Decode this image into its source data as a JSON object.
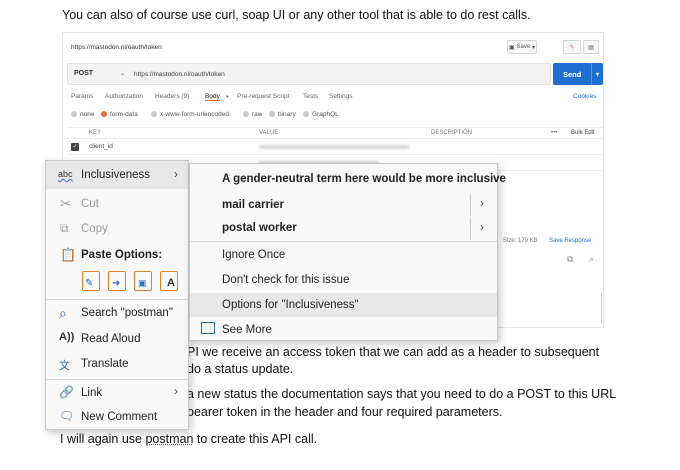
{
  "doc": {
    "para_top": "You can also of course use curl, soap UI or any other tool that is able to do rest calls.",
    "line1": "PI we receive an access token that we can add as a header to subsequent",
    "line2": "do a status update.",
    "line3": "a new status the documentation says that you need to do a POST to this URL",
    "line4": "bearer token in the header and four required parameters.",
    "line5_before": "I will again use ",
    "line5_word": "postman",
    "line5_after": " to create this API call."
  },
  "postman": {
    "tab_url": "https://mastodon.nl/oauth/token",
    "save_label": "Save",
    "method": "POST",
    "request_url": "https://mastodon.nl/oauth/token",
    "send_label": "Send",
    "tabs": [
      "Params",
      "Authorization",
      "Headers (9)",
      "Body",
      "Pre-request Script",
      "Tests",
      "Settings"
    ],
    "cookies": "Cookies",
    "body_types": [
      "none",
      "form-data",
      "x-www-form-urlencoded",
      "raw",
      "binary",
      "GraphQL"
    ],
    "columns": [
      "KEY",
      "VALUE",
      "DESCRIPTION",
      "Bulk Edit"
    ],
    "row1_key": "client_id",
    "size": "Size: 179 KB",
    "save_response": "Save Response"
  },
  "context_menu": {
    "inclusiveness": "Inclusiveness",
    "cut": "Cut",
    "copy": "Copy",
    "paste_options": "Paste Options:",
    "search": "Search \"postman\"",
    "read_aloud": "Read Aloud",
    "translate": "Translate",
    "link": "Link",
    "new_comment": "New Comment"
  },
  "submenu": {
    "heading": "A gender-neutral term here would be more inclusive",
    "suggestion1": "mail carrier",
    "suggestion2": "postal worker",
    "ignore": "Ignore Once",
    "dont_check": "Don't check for this issue",
    "options": "Options for \"Inclusiveness\"",
    "see_more": "See More"
  },
  "colors": {
    "send_blue": "#1f6fd0",
    "postman_orange": "#e46f3a",
    "menu_bg": "#f9f9f9",
    "icon_blue": "#2b6cb0",
    "icon_orange": "#d9822b"
  }
}
